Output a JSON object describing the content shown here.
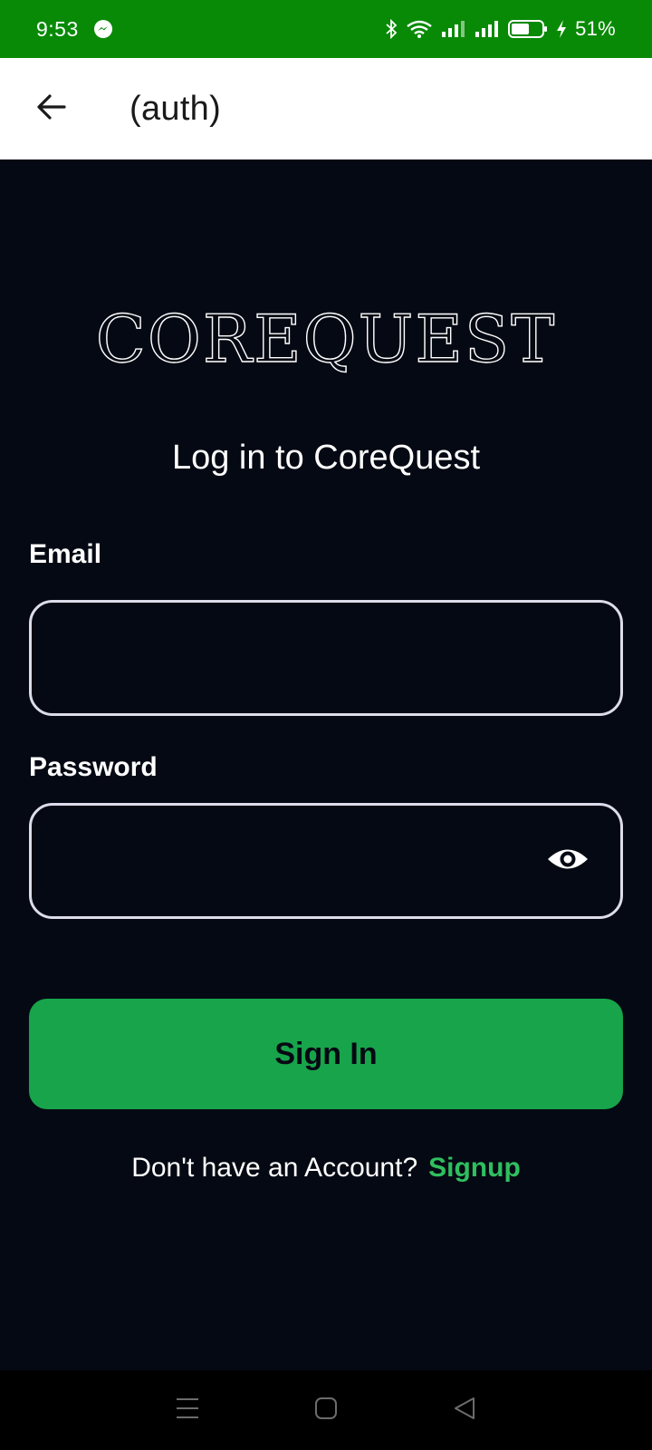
{
  "status_bar": {
    "time": "9:53",
    "battery": "51%",
    "background": "#088a06",
    "icons": [
      "messenger-icon",
      "bluetooth-icon",
      "wifi-icon",
      "signal-icon",
      "signal-icon",
      "battery-icon",
      "charging-icon"
    ]
  },
  "app_bar": {
    "title": "(auth)",
    "back_icon": "arrow-left-icon"
  },
  "logo": {
    "text": "COREQUEST"
  },
  "heading": "Log in to CoreQuest",
  "form": {
    "email_label": "Email",
    "email_value": "",
    "password_label": "Password",
    "password_value": "",
    "password_toggle_icon": "eye-icon",
    "submit_label": "Sign In",
    "submit_color": "#18a44b"
  },
  "signup": {
    "prompt": "Don't have an Account?",
    "link": "Signup",
    "link_color": "#2fbf5f"
  },
  "nav_bar": {
    "icons": [
      "menu-icon",
      "home-icon",
      "back-icon"
    ]
  },
  "theme": {
    "background": "#050913",
    "input_border": "#dcdcea"
  }
}
